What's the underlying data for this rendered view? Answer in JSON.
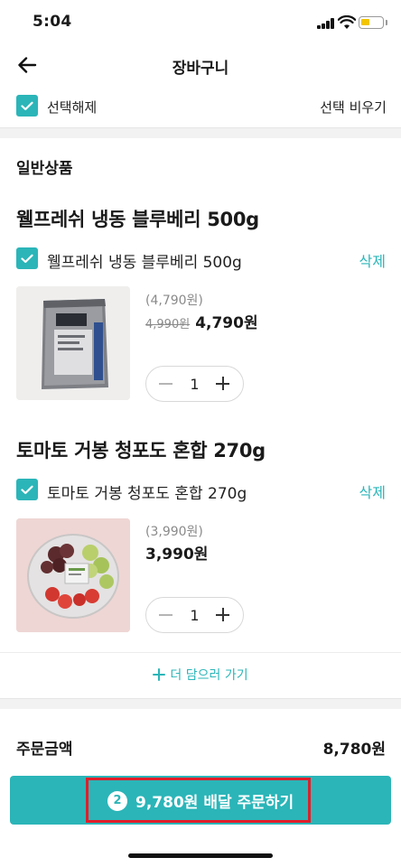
{
  "status_bar": {
    "time": "5:04"
  },
  "header": {
    "title": "장바구니",
    "back_icon": "arrow-left-icon"
  },
  "selection": {
    "select_label": "선택해제",
    "clear_selected_label": "선택 비우기"
  },
  "section": {
    "title": "일반상품"
  },
  "items": [
    {
      "name": "웰프레쉬 냉동 블루베리 500g",
      "option_label": "웰프레쉬 냉동 블루베리 500g",
      "delete_label": "삭제",
      "unit_price": "(4,790원)",
      "original_price": "4,990원",
      "price": "4,790원",
      "quantity": "1",
      "checked": true
    },
    {
      "name": "토마토 거봉 청포도 혼합 270g",
      "option_label": "토마토 거봉 청포도 혼합 270g",
      "delete_label": "삭제",
      "unit_price": "(3,990원)",
      "price": "3,990원",
      "quantity": "1",
      "checked": true
    }
  ],
  "add_more": {
    "label": "더 담으러 가기"
  },
  "summary": {
    "order_amount_label": "주문금액",
    "order_amount_value": "8,780원"
  },
  "order_button": {
    "count": "2",
    "label": "9,780원 배달 주문하기"
  },
  "colors": {
    "accent": "#2bb5b8",
    "highlight_border": "#e01e2a"
  }
}
